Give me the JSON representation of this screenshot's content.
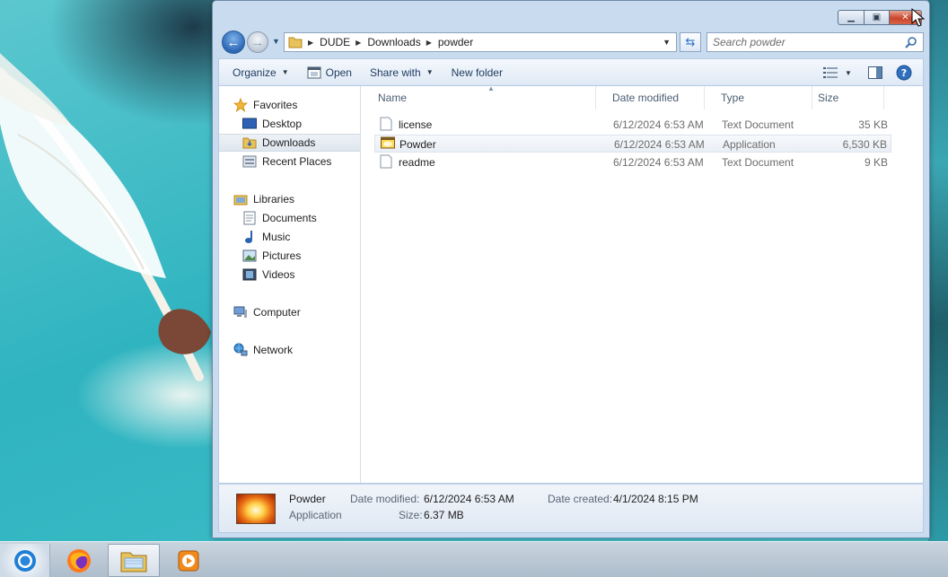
{
  "window": {
    "breadcrumb": [
      "DUDE",
      "Downloads",
      "powder"
    ],
    "search_placeholder": "Search powder"
  },
  "toolbar": {
    "organize": "Organize",
    "open": "Open",
    "share_with": "Share with",
    "new_folder": "New folder"
  },
  "nav": {
    "favorites": "Favorites",
    "desktop": "Desktop",
    "downloads": "Downloads",
    "recent_places": "Recent Places",
    "libraries": "Libraries",
    "documents": "Documents",
    "music": "Music",
    "pictures": "Pictures",
    "videos": "Videos",
    "computer": "Computer",
    "network": "Network"
  },
  "columns": {
    "name": "Name",
    "date_modified": "Date modified",
    "type": "Type",
    "size": "Size"
  },
  "files": [
    {
      "name": "license",
      "date": "6/12/2024 6:53 AM",
      "type": "Text Document",
      "size": "35 KB",
      "icon": "text-document-icon"
    },
    {
      "name": "Powder",
      "date": "6/12/2024 6:53 AM",
      "type": "Application",
      "size": "6,530 KB",
      "icon": "application-icon"
    },
    {
      "name": "readme",
      "date": "6/12/2024 6:53 AM",
      "type": "Text Document",
      "size": "9 KB",
      "icon": "text-document-icon"
    }
  ],
  "details": {
    "name": "Powder",
    "type": "Application",
    "date_modified_label": "Date modified:",
    "date_modified": "6/12/2024 6:53 AM",
    "date_created_label": "Date created:",
    "date_created": "4/1/2024 8:15 PM",
    "size_label": "Size:",
    "size": "6.37 MB"
  },
  "taskbar": {
    "items": [
      "chrome-icon",
      "firefox-icon",
      "file-explorer-icon",
      "media-player-icon"
    ]
  },
  "colors": {
    "accent": "#2c67b6",
    "window_frame": "#c9dcef",
    "close_button": "#c8452c"
  }
}
